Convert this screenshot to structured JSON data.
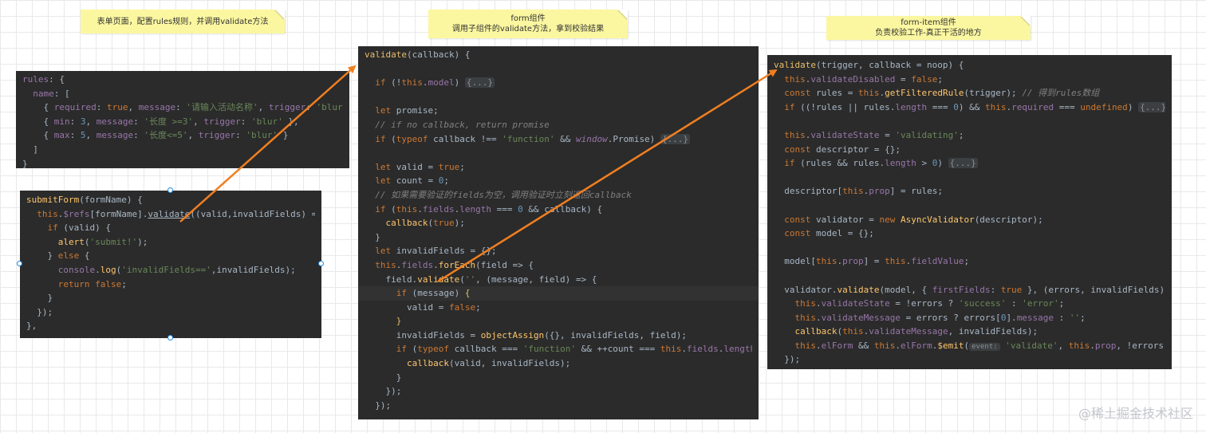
{
  "notes": {
    "page": "表单页面，配置rules规则，并调用validate方法",
    "form_title": "form组件",
    "form_desc": "调用子组件的validate方法，拿到校验结果",
    "item_title": "form-item组件",
    "item_desc": "负责校验工作-真正干活的地方"
  },
  "watermark": "@稀土掘金技术社区",
  "colors": {
    "code_bg": "#2b2b2b",
    "note_bg": "#fbf7a0",
    "arrow": "#f07f21",
    "keyword": "#cc7832",
    "string": "#6a8759",
    "function": "#ffc66d",
    "property": "#9876aa"
  },
  "code": {
    "rules": [
      "rules: {",
      "  name: [",
      "    { required: true, message: '请输入活动名称', trigger: 'blur' },",
      "    { min: 3, message: '长度 >=3', trigger: 'blur' },",
      "    { max: 5, message: '长度<=5', trigger: 'blur' }",
      "  ]",
      "}"
    ],
    "submit": [
      "submitForm(formName) {",
      "  this.$refs[formName].validate((valid,invalidFields) => {",
      "    if (valid) {",
      "      alert('submit!');",
      "    } else {",
      "      console.log('invalidFields==',invalidFields);",
      "      return false;",
      "    }",
      "  });",
      "},"
    ],
    "form": [
      "validate(callback) {",
      "",
      "  if (!this.model) {...}",
      "",
      "  let promise;",
      "  // if no callback, return promise",
      "  if (typeof callback !== 'function' && window.Promise) {...}",
      "",
      "  let valid = true;",
      "  let count = 0;",
      "  // 如果需要验证的fields为空，调用验证时立刻返回callback",
      "  if (this.fields.length === 0 && callback) {",
      "    callback(true);",
      "  }",
      "  let invalidFields = {};",
      "  this.fields.forEach(field => {",
      "    field.validate('', (message, field) => {",
      "      if (message) {",
      "        valid = false;",
      "      }",
      "      invalidFields = objectAssign({}, invalidFields, field);",
      "      if (typeof callback === 'function' && ++count === this.fields.length) {",
      "        callback(valid, invalidFields);",
      "      }",
      "    });",
      "  });"
    ],
    "item": [
      "validate(trigger, callback = noop) {",
      "  this.validateDisabled = false;",
      "  const rules = this.getFilteredRule(trigger); // 得到rules数组",
      "  if ((!rules || rules.length === 0) && this.required === undefined) {...}",
      "",
      "  this.validateState = 'validating';",
      "  const descriptor = {};",
      "  if (rules && rules.length > 0) {...}",
      "",
      "  descriptor[this.prop] = rules;",
      "",
      "  const validator = new AsyncValidator(descriptor);",
      "  const model = {};",
      "",
      "  model[this.prop] = this.fieldValue;",
      "",
      "  validator.validate(model, { firstFields: true }, (errors, invalidFields) =>",
      "    this.validateState = !errors ? 'success' : 'error';",
      "    this.validateMessage = errors ? errors[0].message : '';",
      "    callback(this.validateMessage, invalidFields);",
      "    this.elForm && this.elForm.$emit(event: 'validate', this.prop, !errors, this",
      "  });"
    ]
  }
}
